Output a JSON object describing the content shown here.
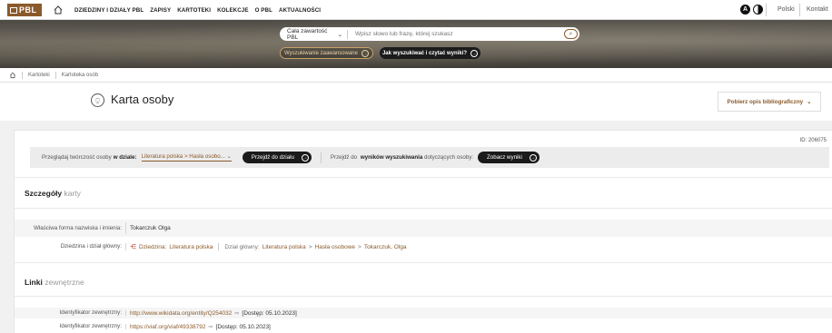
{
  "topbar": {
    "logo": "PBL",
    "nav": [
      "DZIEDZINY I DZIAŁY PBL",
      "ZAPISY",
      "KARTOTEKI",
      "KOLEKCJE",
      "O PBL",
      "AKTUALNOŚCI"
    ],
    "lang": "Polski",
    "contact": "Kontakt"
  },
  "search": {
    "scope": "Cała zawartość PBL",
    "placeholder": "Wpisz słowo lub frazę, której szukasz",
    "advanced": "Wyszukiwanie zaawansowane",
    "how_to": "Jak wyszukiwać i czytać wyniki?"
  },
  "breadcrumb": [
    "Kartoteki",
    "Kartoteka osób"
  ],
  "page": {
    "title": "Karta osoby",
    "bib_button": "Pobierz opis bibliograficzny"
  },
  "card": {
    "id": "ID: 206075",
    "browse_prefix": "Przeglądaj twórczość osoby",
    "browse_bold": "w dziale:",
    "browse_select": "Literatura polska > Hasła osobo...",
    "go_dept": "Przejdź do działu",
    "results_prefix": "Przejdź do",
    "results_bold": "wyników wyszukiwania",
    "results_suffix": "dotyczących osoby:",
    "see_results": "Zobacz wyniki"
  },
  "details": {
    "title_bold": "Szczegóły",
    "title_light": "karty",
    "name_label": "Właściwa forma nazwiska i imienia:",
    "name_value": "Tokarczuk Olga",
    "field_label": "Dziedzina i dział główny:",
    "field_prefix": "Dziedzina:",
    "field_value": "Literatura polska",
    "dept_prefix": "Dział główny:",
    "dept_path": [
      "Literatura polska",
      "Hasła osobowe",
      "Tokarczuk, Olga"
    ]
  },
  "links": {
    "title_bold": "Linki",
    "title_light": "zewnętrzne",
    "rows": [
      {
        "label": "Identyfikator zewnętrzny:",
        "url": "http://www.wikidata.org/entity/Q254032",
        "access": "[Dostęp: 05.10.2023]"
      },
      {
        "label": "Identyfikator zewnętrzny:",
        "url": "https://viaf.org/viaf/49338792",
        "access": "[Dostęp: 05.10.2023]"
      }
    ]
  }
}
